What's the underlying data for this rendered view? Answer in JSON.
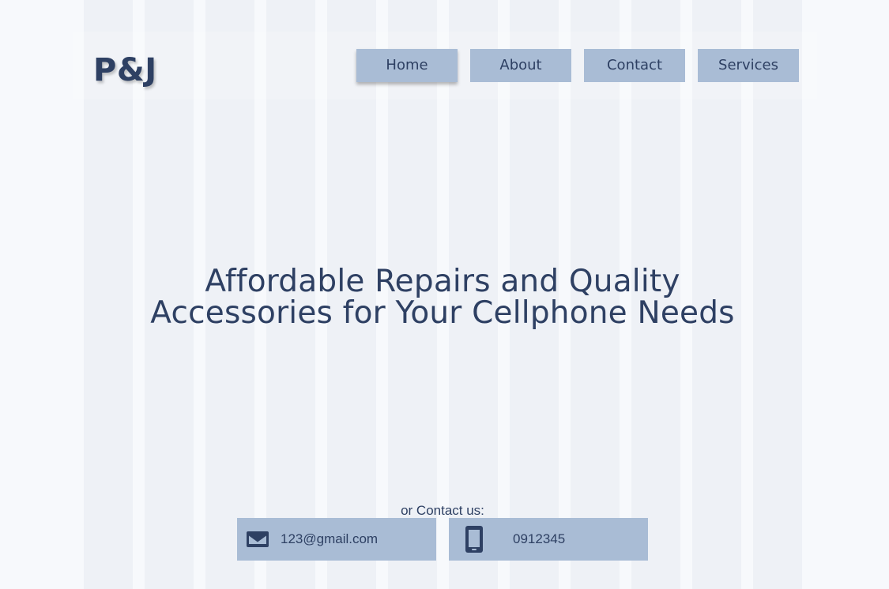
{
  "brand": {
    "logo_text": "P&J"
  },
  "nav": {
    "items": [
      {
        "label": "Home",
        "active": true
      },
      {
        "label": "About",
        "active": false
      },
      {
        "label": "Contact",
        "active": false
      },
      {
        "label": "Services",
        "active": false
      }
    ]
  },
  "hero": {
    "title_line1": "Affordable Repairs and Quality",
    "title_line2": "Accessories for Your Cellphone Needs"
  },
  "contact": {
    "label": "or Contact us:",
    "email": {
      "icon": "mail-icon",
      "value": "123@gmail.com"
    },
    "phone": {
      "icon": "phone-icon",
      "value": "0912345"
    }
  },
  "colors": {
    "background": "#f7f9fc",
    "grid_column": "#eef1f6",
    "button": "#a9bcd5",
    "text": "#2e4063"
  }
}
